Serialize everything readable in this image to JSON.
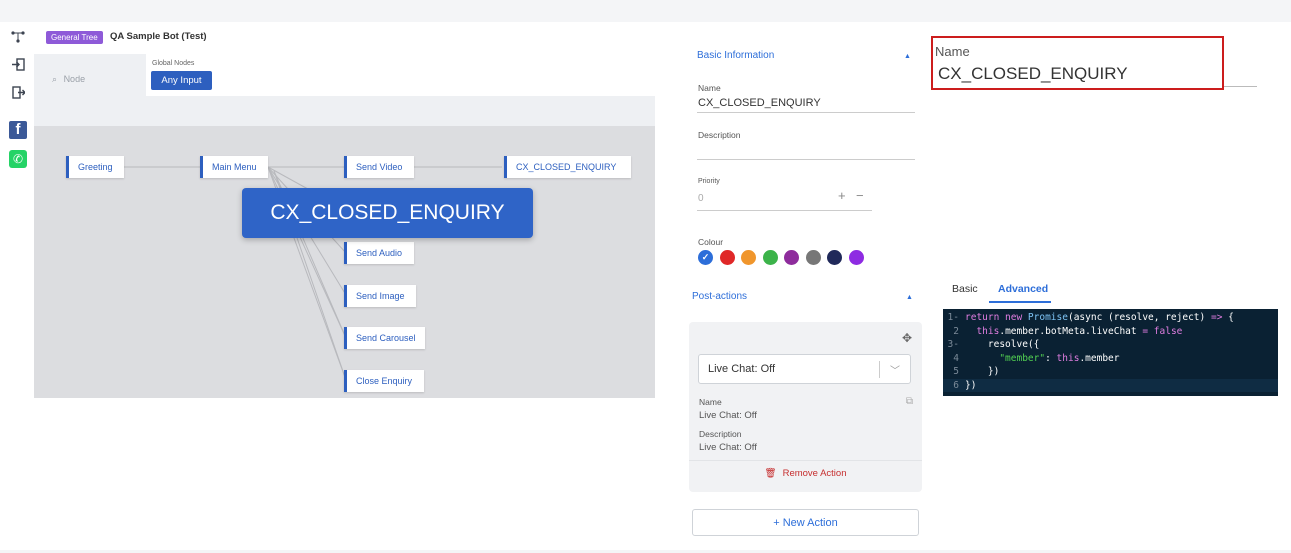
{
  "rail_icons": [
    "tree-icon",
    "import-icon",
    "export-icon",
    "facebook-icon",
    "whatsapp-icon"
  ],
  "header": {
    "tag": "General Tree",
    "bot_title": "QA Sample Bot (Test)"
  },
  "toolbar": {
    "search_placeholder": "Node",
    "global_nodes_label": "Global Nodes",
    "any_input": "Any Input"
  },
  "canvas": {
    "nodes": [
      "Greeting",
      "Main Menu",
      "Send Video",
      "CX_CLOSED_ENQUIRY",
      "Send Audio",
      "Send Image",
      "Send Carousel",
      "Close Enquiry"
    ],
    "overlay_node": "CX_CLOSED_ENQUIRY"
  },
  "panel": {
    "basic_title": "Basic Information",
    "name_label": "Name",
    "name_value": "CX_CLOSED_ENQUIRY",
    "description_label": "Description",
    "priority_label": "Priority",
    "priority_value": "0",
    "plus": "+",
    "minus": "−",
    "colour_label": "Colour",
    "colours": [
      "#2d6ed9",
      "#e02828",
      "#f0962c",
      "#3cb34a",
      "#8e2c9c",
      "#777777",
      "#20295a",
      "#8e2be2"
    ],
    "post_actions_title": "Post-actions",
    "action": {
      "select_value": "Live Chat: Off",
      "name_label": "Name",
      "name_value": "Live Chat: Off",
      "description_label": "Description",
      "description_value": "Live Chat: Off",
      "remove_label": "Remove Action"
    },
    "new_action_label": "+ New Action"
  },
  "callout": {
    "label": "Name",
    "value": "CX_CLOSED_ENQUIRY"
  },
  "tabs": {
    "basic": "Basic",
    "advanced": "Advanced"
  },
  "code_lines": [
    "return new Promise(async (resolve, reject) => {",
    "  this.member.botMeta.liveChat = false",
    "  resolve({",
    "    \"member\": this.member",
    "  })",
    "})"
  ]
}
